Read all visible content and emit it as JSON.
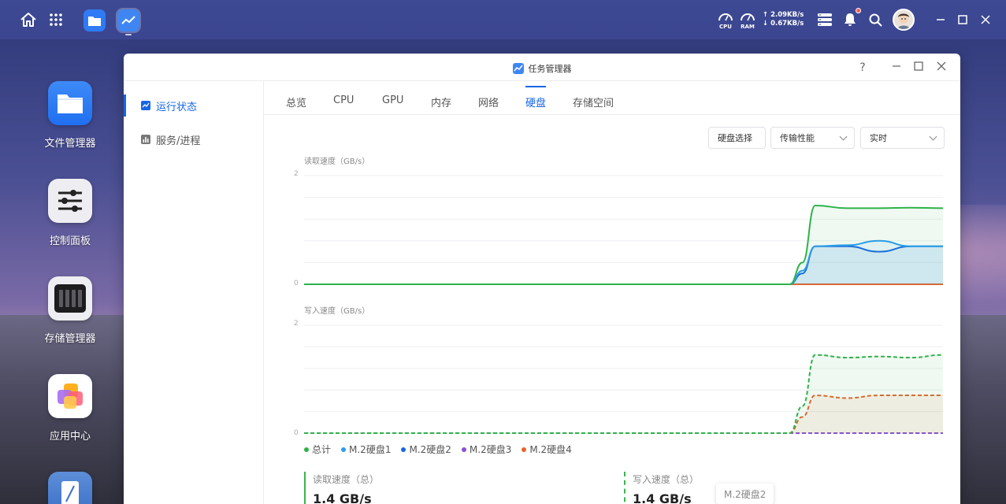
{
  "topbar": {
    "gauges": [
      {
        "label": "CPU",
        "icon": "speedometer-icon"
      },
      {
        "label": "RAM",
        "icon": "speedometer-icon"
      }
    ],
    "upload": "↑ 2.09KB/s",
    "download": "↓ 0.67KB/s"
  },
  "desktop": {
    "apps": [
      {
        "label": "文件管理器",
        "icon": "folder-icon"
      },
      {
        "label": "控制面板",
        "icon": "sliders-icon"
      },
      {
        "label": "存储管理器",
        "icon": "storage-icon"
      },
      {
        "label": "应用中心",
        "icon": "app-center-icon"
      }
    ]
  },
  "window": {
    "title": "任务管理器",
    "help": "?",
    "sidebar": [
      {
        "label": "运行状态",
        "active": true
      },
      {
        "label": "服务/进程",
        "active": false
      }
    ],
    "tabs": [
      {
        "label": "总览"
      },
      {
        "label": "CPU"
      },
      {
        "label": "GPU"
      },
      {
        "label": "内存"
      },
      {
        "label": "网络"
      },
      {
        "label": "硬盘",
        "active": true
      },
      {
        "label": "存储空间"
      }
    ],
    "controls": {
      "disk_select": "硬盘选择",
      "metric": "传输性能",
      "range": "实时"
    },
    "charts": [
      {
        "title": "读取速度（GB/s）",
        "ymax_label": "2",
        "ymin_label": "0"
      },
      {
        "title": "写入速度（GB/s）",
        "ymax_label": "2",
        "ymin_label": "0"
      }
    ],
    "legend": [
      {
        "label": "总计",
        "color": "#2db34a"
      },
      {
        "label": "M.2硬盘1",
        "color": "#2a9df4"
      },
      {
        "label": "M.2硬盘2",
        "color": "#1666e6"
      },
      {
        "label": "M.2硬盘3",
        "color": "#8a4fd6"
      },
      {
        "label": "M.2硬盘4",
        "color": "#e8642a"
      }
    ],
    "stats": {
      "read_label": "读取速度（总）",
      "read_value": "1.4 GB/s",
      "write_label": "写入速度（总）",
      "write_value": "1.4 GB/s"
    },
    "tooltip": "M.2硬盘2"
  },
  "chart_data": [
    {
      "type": "line",
      "title": "读取速度（GB/s）",
      "ylim": [
        0,
        2
      ],
      "x": [
        0,
        10,
        20,
        30,
        40,
        50,
        60,
        70,
        76,
        78,
        80,
        85,
        90,
        95,
        100
      ],
      "series": [
        {
          "name": "总计",
          "values": [
            0,
            0,
            0,
            0,
            0,
            0,
            0,
            0,
            0,
            0.4,
            1.45,
            1.4,
            1.4,
            1.41,
            1.4
          ]
        },
        {
          "name": "M.2硬盘1",
          "values": [
            0,
            0,
            0,
            0,
            0,
            0,
            0,
            0,
            0,
            0.25,
            0.7,
            0.72,
            0.8,
            0.7,
            0.7
          ]
        },
        {
          "name": "M.2硬盘2",
          "values": [
            0,
            0,
            0,
            0,
            0,
            0,
            0,
            0,
            0,
            0.2,
            0.7,
            0.7,
            0.6,
            0.7,
            0.7
          ]
        },
        {
          "name": "M.2硬盘3",
          "values": [
            0,
            0,
            0,
            0,
            0,
            0,
            0,
            0,
            0,
            0,
            0,
            0,
            0,
            0,
            0
          ]
        },
        {
          "name": "M.2硬盘4",
          "values": [
            0,
            0,
            0,
            0,
            0,
            0,
            0,
            0,
            0,
            0,
            0,
            0,
            0,
            0,
            0
          ]
        }
      ]
    },
    {
      "type": "line",
      "title": "写入速度（GB/s）",
      "ylim": [
        0,
        2
      ],
      "x": [
        0,
        10,
        20,
        30,
        40,
        50,
        60,
        70,
        76,
        78,
        80,
        85,
        90,
        95,
        100
      ],
      "series": [
        {
          "name": "总计",
          "values": [
            0,
            0,
            0,
            0,
            0,
            0,
            0,
            0,
            0,
            0.5,
            1.45,
            1.4,
            1.42,
            1.4,
            1.45
          ]
        },
        {
          "name": "M.2硬盘1",
          "values": [
            0,
            0,
            0,
            0,
            0,
            0,
            0,
            0,
            0,
            0,
            0,
            0,
            0,
            0,
            0
          ]
        },
        {
          "name": "M.2硬盘2",
          "values": [
            0,
            0,
            0,
            0,
            0,
            0,
            0,
            0,
            0,
            0,
            0,
            0,
            0,
            0,
            0
          ]
        },
        {
          "name": "M.2硬盘3",
          "values": [
            0,
            0,
            0,
            0,
            0,
            0,
            0,
            0,
            0,
            0,
            0,
            0,
            0,
            0,
            0
          ]
        },
        {
          "name": "M.2硬盘4",
          "values": [
            0,
            0,
            0,
            0,
            0,
            0,
            0,
            0,
            0,
            0.3,
            0.7,
            0.65,
            0.7,
            0.7,
            0.7
          ]
        }
      ]
    }
  ]
}
